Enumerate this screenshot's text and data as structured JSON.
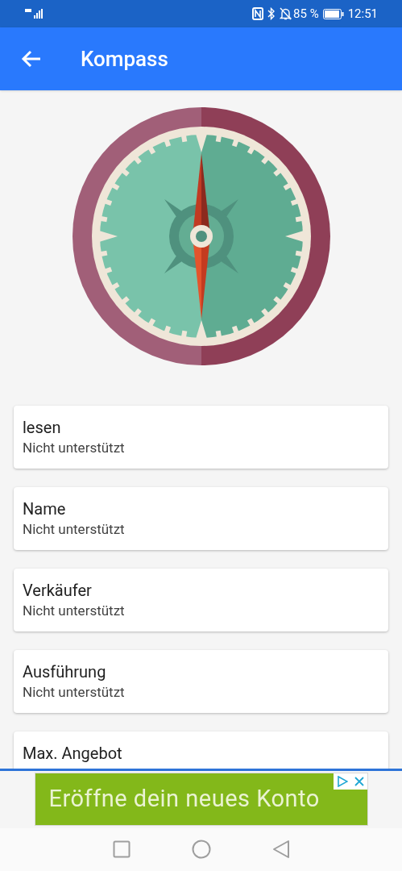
{
  "status_bar": {
    "battery": "85 %",
    "time": "12:51"
  },
  "app_bar": {
    "title": "Kompass"
  },
  "items": [
    {
      "title": "lesen",
      "value": "Nicht unterstützt"
    },
    {
      "title": "Name",
      "value": "Nicht unterstützt"
    },
    {
      "title": "Verkäufer",
      "value": "Nicht unterstützt"
    },
    {
      "title": "Ausführung",
      "value": "Nicht unterstützt"
    },
    {
      "title": "Max. Angebot"
    }
  ],
  "ad": {
    "text": "Eröffne dein neues Konto"
  }
}
